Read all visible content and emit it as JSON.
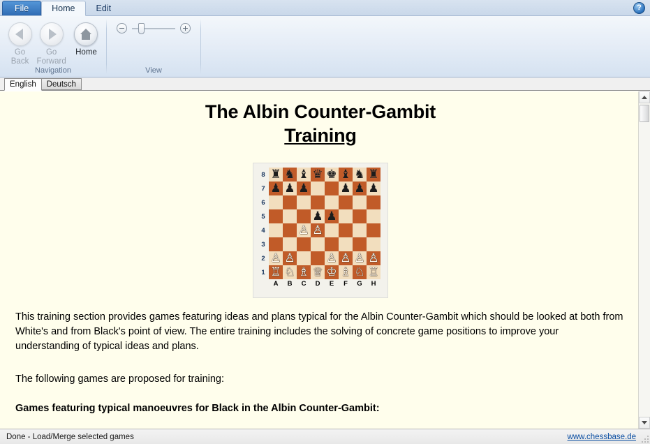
{
  "window": {
    "help_icon": "?"
  },
  "ribbon": {
    "tabs": [
      {
        "label": "File",
        "type": "file"
      },
      {
        "label": "Home",
        "type": "normal"
      },
      {
        "label": "Edit",
        "type": "normal"
      }
    ],
    "groups": {
      "navigation": {
        "title": "Navigation",
        "buttons": [
          {
            "label_line1": "Go",
            "label_line2": "Back",
            "icon": "arrow-left-icon",
            "enabled": false
          },
          {
            "label_line1": "Go",
            "label_line2": "Forward",
            "icon": "arrow-right-icon",
            "enabled": false
          },
          {
            "label_line1": "Home",
            "label_line2": "",
            "icon": "home-icon",
            "enabled": true
          }
        ]
      },
      "view": {
        "title": "View",
        "zoom_out_label": "−",
        "zoom_in_label": "+"
      }
    }
  },
  "language_tabs": [
    {
      "label": "English",
      "active": true
    },
    {
      "label": "Deutsch",
      "active": false
    }
  ],
  "document": {
    "title_line1": "The Albin Counter-Gambit",
    "title_line2": "Training",
    "paragraph1": "This training section provides games featuring ideas and plans typical for the Albin Counter-Gambit which should be looked at both from White's and from Black's point of view. The entire training includes the solving of concrete game positions to improve your understanding of typical ideas and plans.",
    "paragraph2": "The following games are proposed for training:",
    "heading_black_games": "Games featuring typical manoeuvres for Black in the Albin Counter-Gambit:"
  },
  "chessboard": {
    "ranks": [
      "8",
      "7",
      "6",
      "5",
      "4",
      "3",
      "2",
      "1"
    ],
    "files": [
      "A",
      "B",
      "C",
      "D",
      "E",
      "F",
      "G",
      "H"
    ],
    "light_square_color": "#f2debe",
    "dark_square_color": "#c15b28",
    "position_name": "Albin Counter-Gambit",
    "rows": [
      [
        "bR",
        "bN",
        "bB",
        "bQ",
        "bK",
        "bB",
        "bN",
        "bR"
      ],
      [
        "bP",
        "bP",
        "bP",
        "",
        "",
        "bP",
        "bP",
        "bP"
      ],
      [
        "",
        "",
        "",
        "",
        "",
        "",
        "",
        ""
      ],
      [
        "",
        "",
        "",
        "bP",
        "bP",
        "",
        "",
        ""
      ],
      [
        "",
        "",
        "wP",
        "wP",
        "",
        "",
        "",
        ""
      ],
      [
        "",
        "",
        "",
        "",
        "",
        "",
        "",
        ""
      ],
      [
        "wP",
        "wP",
        "",
        "",
        "wP",
        "wP",
        "wP",
        "wP"
      ],
      [
        "wR",
        "wN",
        "wB",
        "wQ",
        "wK",
        "wB",
        "wN",
        "wR"
      ]
    ],
    "glyphs": {
      "wK": "♔",
      "wQ": "♕",
      "wR": "♖",
      "wB": "♗",
      "wN": "♘",
      "wP": "♙",
      "bK": "♚",
      "bQ": "♛",
      "bR": "♜",
      "bB": "♝",
      "bN": "♞",
      "bP": "♟"
    }
  },
  "scrollbar": {
    "up_arrow": "▲",
    "down_arrow": "▼"
  },
  "statusbar": {
    "message": "Done - Load/Merge selected games",
    "link": "www.chessbase.de"
  }
}
